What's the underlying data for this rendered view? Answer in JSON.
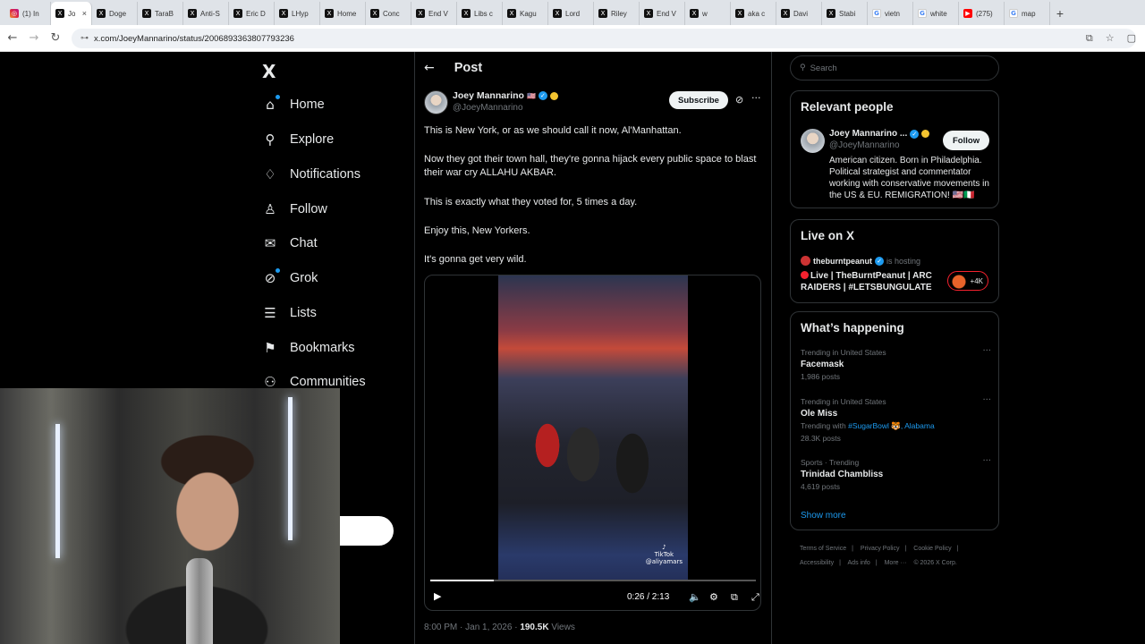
{
  "browser": {
    "tabs": [
      {
        "label": "(1) In",
        "icon": "instagram-icon"
      },
      {
        "label": "Jo",
        "icon": "x-icon",
        "active": true
      },
      {
        "label": "Doge",
        "icon": "x-icon"
      },
      {
        "label": "TaraB",
        "icon": "x-icon"
      },
      {
        "label": "Anti-S",
        "icon": "x-icon"
      },
      {
        "label": "Eric D",
        "icon": "x-icon"
      },
      {
        "label": "LHyp",
        "icon": "x-icon"
      },
      {
        "label": "Home",
        "icon": "x-icon"
      },
      {
        "label": "Conc",
        "icon": "x-icon"
      },
      {
        "label": "End V",
        "icon": "x-icon"
      },
      {
        "label": "Libs c",
        "icon": "x-icon"
      },
      {
        "label": "Kagu",
        "icon": "x-icon"
      },
      {
        "label": "Lord",
        "icon": "x-icon"
      },
      {
        "label": "Riley",
        "icon": "x-icon"
      },
      {
        "label": "End V",
        "icon": "x-icon"
      },
      {
        "label": "w",
        "icon": "x-icon"
      },
      {
        "label": "aka c",
        "icon": "x-icon"
      },
      {
        "label": "Davi",
        "icon": "x-icon"
      },
      {
        "label": "Stabi",
        "icon": "x-icon"
      },
      {
        "label": "vietn",
        "icon": "google-icon"
      },
      {
        "label": "white",
        "icon": "google-icon"
      },
      {
        "label": "(275)",
        "icon": "youtube-icon"
      },
      {
        "label": "map",
        "icon": "google-icon"
      }
    ],
    "url": "x.com/JoeyMannarino/status/2006893363807793236"
  },
  "nav": {
    "logo": "X",
    "items": [
      {
        "label": "Home",
        "icon": "home-icon"
      },
      {
        "label": "Explore",
        "icon": "search-icon"
      },
      {
        "label": "Notifications",
        "icon": "bell-icon"
      },
      {
        "label": "Follow",
        "icon": "add-person-icon"
      },
      {
        "label": "Chat",
        "icon": "mail-icon"
      },
      {
        "label": "Grok",
        "icon": "grok-icon"
      },
      {
        "label": "Lists",
        "icon": "list-icon"
      },
      {
        "label": "Bookmarks",
        "icon": "bookmark-icon"
      },
      {
        "label": "Communities",
        "icon": "communities-icon"
      }
    ]
  },
  "post": {
    "header_title": "Post",
    "author_name": "Joey Mannarino",
    "author_flag": "🇺🇸",
    "author_handle": "@JoeyMannarino",
    "subscribe_label": "Subscribe",
    "paragraphs": [
      "This is New York, or as we should call it now, Al'Manhattan.",
      "Now they got their town hall, they're gonna hijack every public space to blast their war cry ALLAHU AKBAR.",
      "This is exactly what they voted for, 5 times a day.",
      "Enjoy this, New Yorkers.",
      "It's gonna get very wild."
    ],
    "video": {
      "time": "0:26 / 2:13",
      "progress_percent": 19.5,
      "watermark": "TikTok",
      "watermark_handle": "@aliyamars"
    },
    "timestamp": "8:00 PM · Jan 1, 2026",
    "separator": "·",
    "views_count": "190.5K",
    "views_label": "Views"
  },
  "sidebar": {
    "search_placeholder": "Search",
    "relevant": {
      "title": "Relevant people",
      "name": "Joey Mannarino ...",
      "handle": "@JoeyMannarino",
      "follow_label": "Follow",
      "bio": "American citizen. Born in Philadelphia. Political strategist and commentator working with conservative movements in the US & EU. REMIGRATION! 🇺🇸🇮🇹"
    },
    "live": {
      "title": "Live on X",
      "host": "theburntpeanut",
      "hosting": "is hosting",
      "stream_title": "Live | TheBurntPeanut | ARC RAIDERS | #LETSBUNGULATE",
      "count": "+4K"
    },
    "happening": {
      "title": "What’s happening",
      "trends": [
        {
          "category": "Trending in United States",
          "name": "Facemask",
          "sub": "1,986 posts"
        },
        {
          "category": "Trending in United States",
          "name": "Ole Miss",
          "sub_prefix": "Trending with",
          "sub_link": "#SugarBowl 🐯, Alabama",
          "sub": "28.3K posts"
        },
        {
          "category": "Sports · Trending",
          "name": "Trinidad Chambliss",
          "sub": "4,619 posts"
        }
      ],
      "show_more": "Show more"
    },
    "footer": [
      "Terms of Service",
      "|",
      "Privacy Policy",
      "|",
      "Cookie Policy",
      "|",
      "Accessibility",
      "|",
      "Ads info",
      "|",
      "More ···",
      "© 2026 X Corp."
    ]
  },
  "colors": {
    "accent": "#1d9bf0",
    "background": "#000000",
    "border": "#2f3336",
    "muted": "#71767b",
    "live_red": "#f4212e"
  }
}
